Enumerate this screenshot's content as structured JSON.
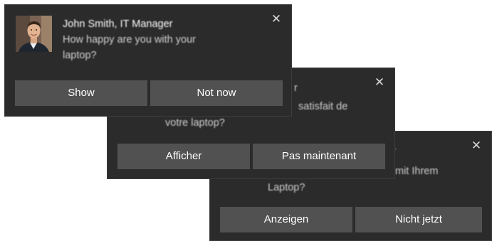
{
  "toasts": {
    "en": {
      "sender": "John Smith, IT Manager",
      "message_line1": "How happy are you with your",
      "message_line2": "laptop?",
      "primary_button": "Show",
      "secondary_button": "Not now",
      "close_glyph": "✕"
    },
    "fr": {
      "visible_fragment_1": "r",
      "visible_fragment_2": "satisfait de",
      "visible_fragment_3": "votre laptop?",
      "primary_button": "Afficher",
      "secondary_button": "Pas maintenant",
      "close_glyph": "✕"
    },
    "de": {
      "visible_fragment_1": "r",
      "visible_fragment_2": "mit Ihrem",
      "visible_fragment_3": "Laptop?",
      "primary_button": "Anzeigen",
      "secondary_button": "Nicht jetzt",
      "close_glyph": "✕"
    }
  },
  "colors": {
    "toast_background": "#2b2b2b",
    "button_background": "#515151",
    "text": "#ffffff"
  },
  "icons": {
    "avatar": "user-avatar-photo",
    "close": "close-icon"
  }
}
